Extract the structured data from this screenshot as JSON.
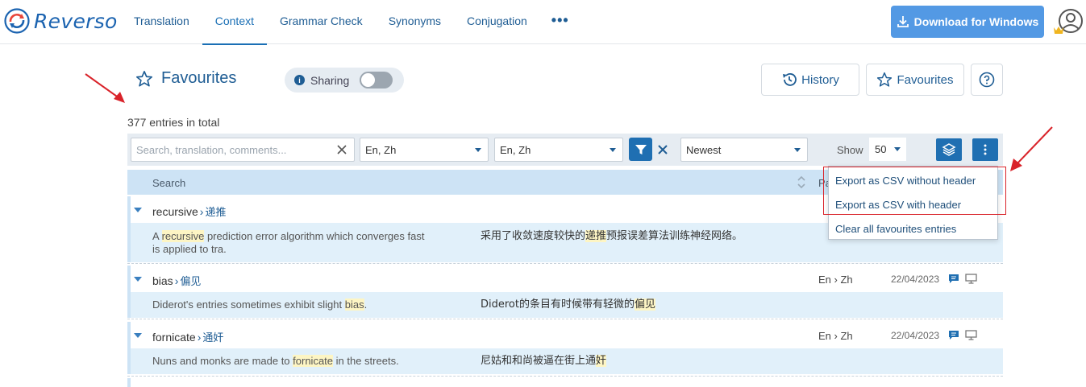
{
  "header": {
    "brand": "Reverso",
    "nav": [
      "Translation",
      "Context",
      "Grammar Check",
      "Synonyms",
      "Conjugation"
    ],
    "nav_active": "Context",
    "more": "•••",
    "download_label": "Download for Windows"
  },
  "page": {
    "title": "Favourites",
    "sharing_label": "Sharing",
    "sharing_on": false,
    "history_label": "History",
    "favourites_label": "Favourites",
    "entries_total": "377 entries in total"
  },
  "filters": {
    "search_placeholder": "Search, translation, comments...",
    "lang1": "En, Zh",
    "lang2": "En, Zh",
    "sort": "Newest",
    "show_label": "Show",
    "show_value": "50"
  },
  "table": {
    "col_search": "Search",
    "col_pair_partial": "Pa",
    "rows": [
      {
        "term": "recursive",
        "translation": "递推",
        "pair": "",
        "date": "",
        "src_before": "A ",
        "src_hl": "recursive",
        "src_after": " prediction error algorithm which converges fast",
        "src_line2": "is applied to tra.",
        "tgt_before": "采用了收敛速度较快的",
        "tgt_hl": "递推",
        "tgt_after": "预报误差算法训练神经网络。"
      },
      {
        "term": "bias",
        "translation": "偏见",
        "pair": "En › Zh",
        "date": "22/04/2023",
        "src_before": "Diderot's entries sometimes exhibit slight ",
        "src_hl": "bias",
        "src_after": ".",
        "tgt_before": "Diderot的条目有时候带有轻微的",
        "tgt_hl": "偏见",
        "tgt_after": ""
      },
      {
        "term": "fornicate",
        "translation": "通奸",
        "pair": "En › Zh",
        "date": "22/04/2023",
        "src_before": "Nuns and monks are made to ",
        "src_hl": "fornicate",
        "src_after": " in the streets.",
        "tgt_before": "尼姑和和尚被逼在街上通",
        "tgt_hl": "奸",
        "tgt_after": ""
      }
    ]
  },
  "menu": {
    "items": [
      "Export as CSV without header",
      "Export as CSV with header",
      "Clear all favourites entries"
    ]
  },
  "colors": {
    "brand": "#1b63b0",
    "accent": "#1f6fb2",
    "download": "#5399e4",
    "annotation": "#d9232a"
  },
  "icons": [
    "reverso-logo-icon",
    "download-icon",
    "user-crown-icon",
    "star-icon",
    "info-icon",
    "history-icon",
    "help-icon",
    "clear-icon",
    "filter-icon",
    "close-icon",
    "layers-icon",
    "more-vertical-icon",
    "sort-icon",
    "comment-icon",
    "screen-icon"
  ]
}
